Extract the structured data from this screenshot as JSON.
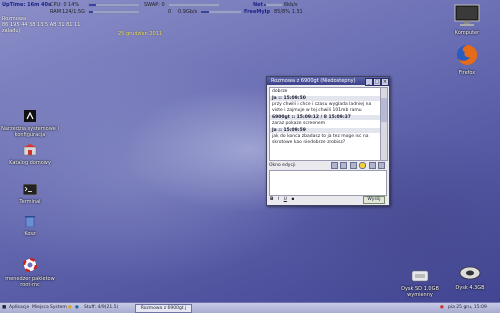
{
  "system_monitor": {
    "line1": {
      "uptime": "UpTime: 16m 40s",
      "cpu": "CPU: 0",
      "cpu_pct": "14%",
      "swap_label": "SWAP: 0",
      "net_label": "Net",
      "net_value": "6kb/s"
    },
    "line2": {
      "ram_label": "RAM",
      "ram_value": "124/1.5G",
      "disk_label": "0",
      "disk_value": "0.9Gb/s",
      "fs_label": "FreeMyIp",
      "fs_value": "85/8% 1.31"
    },
    "levels": {
      "cpu": 0.14,
      "ram": 0.08,
      "swap": 0.0,
      "disk": 0.2,
      "net": 0.1
    }
  },
  "sys_info": [
    "Rozmowa",
    "86 195 44 38 13 5 AB 31 81 11",
    "zaladuj"
  ],
  "date": "25 grudzien 2011",
  "desktop_icons": {
    "left": [
      {
        "label": "Narzedzia systemowe i konfiguracja"
      },
      {
        "label": "Katalog domowy"
      },
      {
        "label": "Terminal"
      },
      {
        "label": "Kosz"
      },
      {
        "label": "menedzer pakietow root-mc"
      }
    ],
    "right": [
      {
        "label": "Komputer"
      },
      {
        "label": "Firefox"
      },
      {
        "label": "Dysk SD 1.0GB wymienny"
      },
      {
        "label": "Dysk 4.3GB"
      }
    ]
  },
  "chat_window": {
    "title": "Rozmowa z 6900gt (Niedostepny)",
    "messages": [
      {
        "header": "",
        "text": "dobrze"
      },
      {
        "header": "Ja :: 15:09:50",
        "text": "przy chwili i chce i czasu wyglada ladniej na viste i zajmuje w tej chwili 101mb ramu"
      },
      {
        "header": "6900gt :: 15:09:12 / 8 15:09:37",
        "text": "zaraz pokaze screenem"
      },
      {
        "header": "Ja :: 15:09:59",
        "text": "jak do konca zbadasz to ja tez moge isc na skrotowe kao niedobrze zrobisz?"
      }
    ],
    "toolbar_label": "Okno edycji",
    "send_label": "Wyslij",
    "format_buttons": [
      "B",
      "I",
      "U"
    ]
  },
  "taskbar": {
    "menu_apps": "Aplikacje",
    "menu_places": "Miejsca",
    "menu_system": "System",
    "status_text": "Stuff: 4/9(21.5)",
    "task_window": "Rozmowa z 6900gt j",
    "clock": "pia 25 gru, 15:09"
  }
}
